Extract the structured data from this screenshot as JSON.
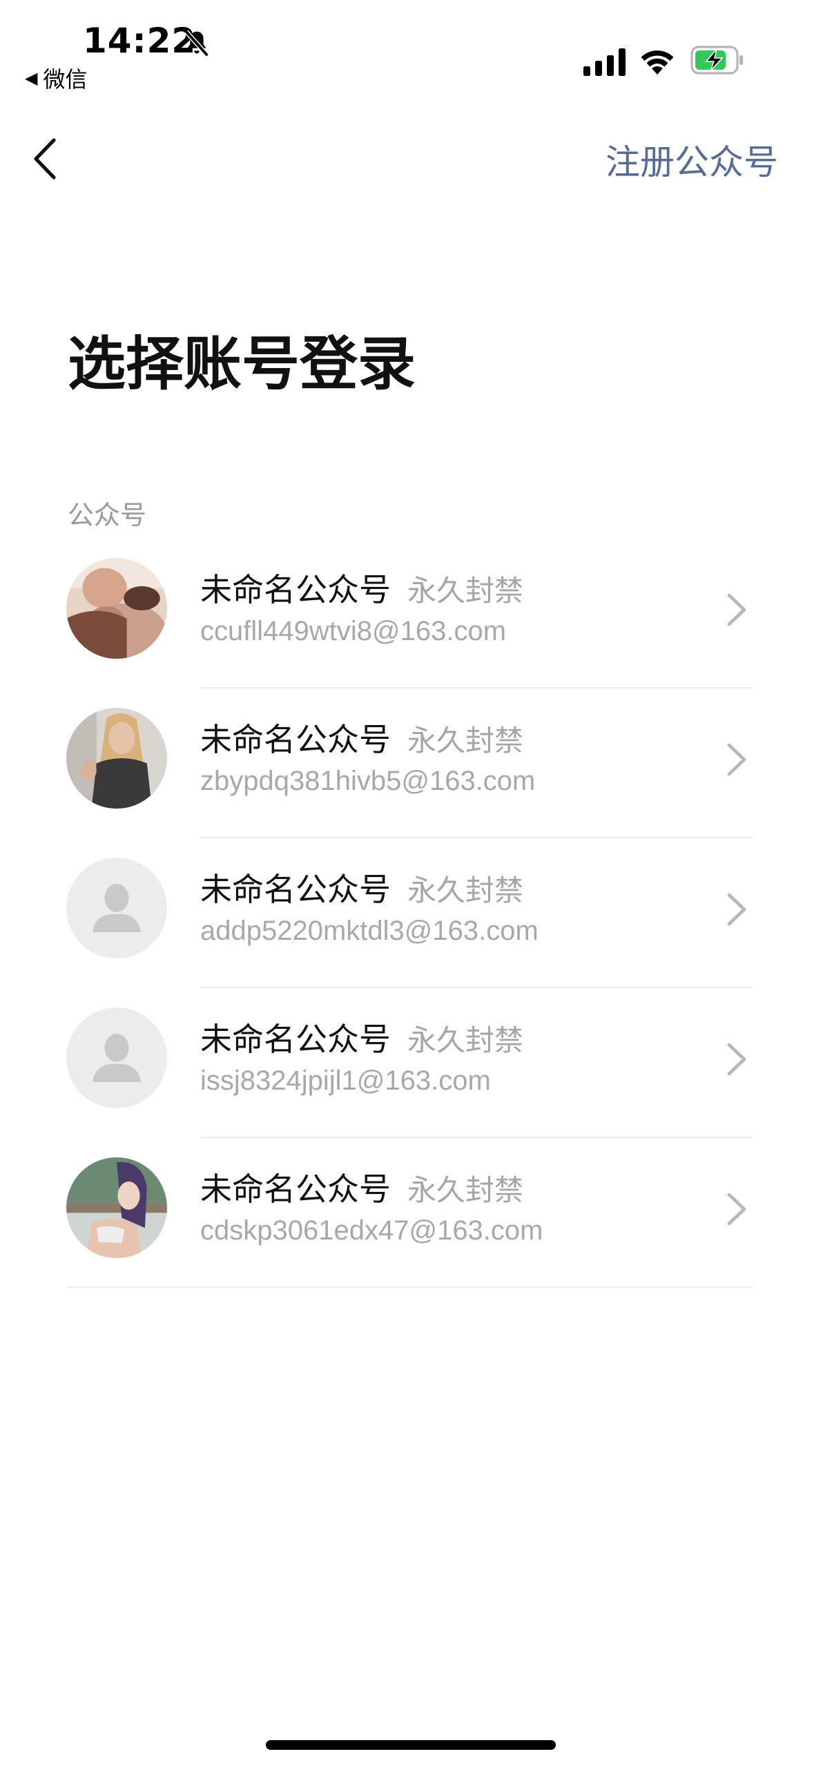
{
  "status_bar": {
    "time": "14:22",
    "back_app": "微信",
    "icons": [
      "bell-muted-icon",
      "signal-icon",
      "wifi-icon",
      "battery-charging-icon"
    ],
    "battery_color": "#34c759"
  },
  "nav": {
    "back_icon": "chevron-left-icon",
    "register_label": "注册公众号",
    "link_color": "#576b95"
  },
  "page": {
    "title": "选择账号登录",
    "section_label": "公众号"
  },
  "accounts": [
    {
      "name": "未命名公众号",
      "status": "永久封禁",
      "email": "ccufll449wtvi8@163.com",
      "avatar": "photo-avatar"
    },
    {
      "name": "未命名公众号",
      "status": "永久封禁",
      "email": "zbypdq381hivb5@163.com",
      "avatar": "photo-avatar"
    },
    {
      "name": "未命名公众号",
      "status": "永久封禁",
      "email": "addp5220mktdl3@163.com",
      "avatar": "default-avatar"
    },
    {
      "name": "未命名公众号",
      "status": "永久封禁",
      "email": "issj8324jpijl1@163.com",
      "avatar": "default-avatar"
    },
    {
      "name": "未命名公众号",
      "status": "永久封禁",
      "email": "cdskp3061edx47@163.com",
      "avatar": "photo-avatar"
    }
  ]
}
